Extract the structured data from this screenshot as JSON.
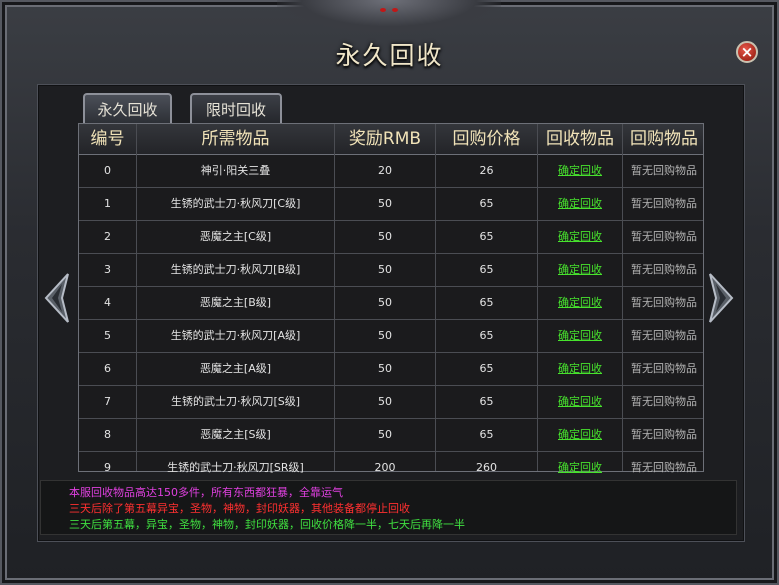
{
  "title": "永久回收",
  "close_label": "×",
  "tabs": [
    {
      "label": "永久回收",
      "active": true
    },
    {
      "label": "限时回收",
      "active": false
    }
  ],
  "columns": [
    "编号",
    "所需物品",
    "奖励RMB",
    "回购价格",
    "回收物品",
    "回购物品"
  ],
  "rows": [
    {
      "id": "0",
      "item": "神引·阳关三叠",
      "reward": "20",
      "price": "26",
      "recycle": "确定回收",
      "buyback": "暂无回购物品"
    },
    {
      "id": "1",
      "item": "生锈的武士刀·秋风刀[C级]",
      "reward": "50",
      "price": "65",
      "recycle": "确定回收",
      "buyback": "暂无回购物品"
    },
    {
      "id": "2",
      "item": "恶魔之主[C级]",
      "reward": "50",
      "price": "65",
      "recycle": "确定回收",
      "buyback": "暂无回购物品"
    },
    {
      "id": "3",
      "item": "生锈的武士刀·秋风刀[B级]",
      "reward": "50",
      "price": "65",
      "recycle": "确定回收",
      "buyback": "暂无回购物品"
    },
    {
      "id": "4",
      "item": "恶魔之主[B级]",
      "reward": "50",
      "price": "65",
      "recycle": "确定回收",
      "buyback": "暂无回购物品"
    },
    {
      "id": "5",
      "item": "生锈的武士刀·秋风刀[A级]",
      "reward": "50",
      "price": "65",
      "recycle": "确定回收",
      "buyback": "暂无回购物品"
    },
    {
      "id": "6",
      "item": "恶魔之主[A级]",
      "reward": "50",
      "price": "65",
      "recycle": "确定回收",
      "buyback": "暂无回购物品"
    },
    {
      "id": "7",
      "item": "生锈的武士刀·秋风刀[S级]",
      "reward": "50",
      "price": "65",
      "recycle": "确定回收",
      "buyback": "暂无回购物品"
    },
    {
      "id": "8",
      "item": "恶魔之主[S级]",
      "reward": "50",
      "price": "65",
      "recycle": "确定回收",
      "buyback": "暂无回购物品"
    },
    {
      "id": "9",
      "item": "生锈的武士刀·秋风刀[SR级]",
      "reward": "200",
      "price": "260",
      "recycle": "确定回收",
      "buyback": "暂无回购物品"
    }
  ],
  "notes": [
    {
      "text": "本服回收物品高达150多件，所有东西都狂暴，全靠运气",
      "color": "#e040e0"
    },
    {
      "text": "三天后除了第五幕异宝，圣物，神物，封印妖器，其他装备都停止回收",
      "color": "#ff3030"
    },
    {
      "text": "三天后第五幕，异宝，圣物，神物，封印妖器，回收价格降一半，七天后再降一半",
      "color": "#40e040"
    }
  ],
  "icons": {
    "close": "close-icon",
    "prev": "arrow-left-icon",
    "next": "arrow-right-icon"
  }
}
